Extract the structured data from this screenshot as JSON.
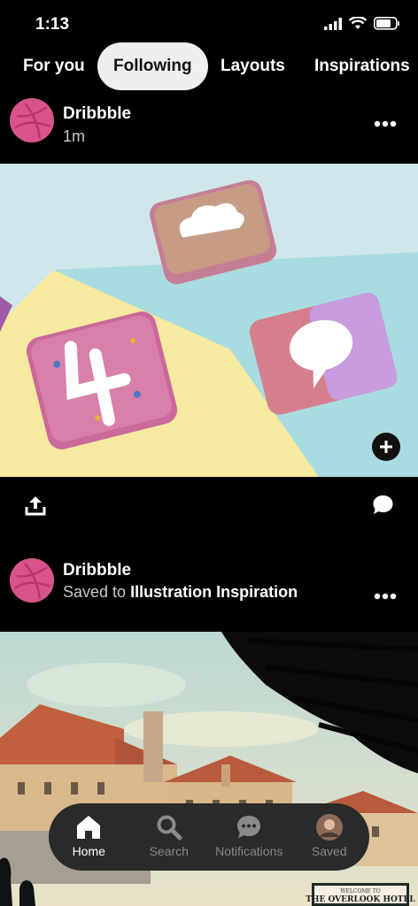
{
  "status_bar": {
    "time": "1:13"
  },
  "tabs": [
    {
      "label": "For you"
    },
    {
      "label": "Following",
      "active": true
    },
    {
      "label": "Layouts"
    },
    {
      "label": "Inspirations"
    }
  ],
  "posts": [
    {
      "author": "Dribbble",
      "subtitle": "1m"
    },
    {
      "author": "Dribbble",
      "saved_prefix": "Saved to",
      "board": "Illustration Inspiration",
      "sign_top": "WELCOME TO",
      "sign_main": "THE OVERLOOK HOTEL"
    }
  ],
  "bottom_nav": [
    {
      "label": "Home",
      "icon": "home-icon",
      "active": true
    },
    {
      "label": "Search",
      "icon": "search-icon"
    },
    {
      "label": "Notifications",
      "icon": "chat-bubble-icon"
    },
    {
      "label": "Saved",
      "icon": "avatar"
    }
  ],
  "colors": {
    "accent_active_tab": "#efefef",
    "avatar_pink": "#d8548b",
    "nav_bg": "#2a2a2a"
  }
}
